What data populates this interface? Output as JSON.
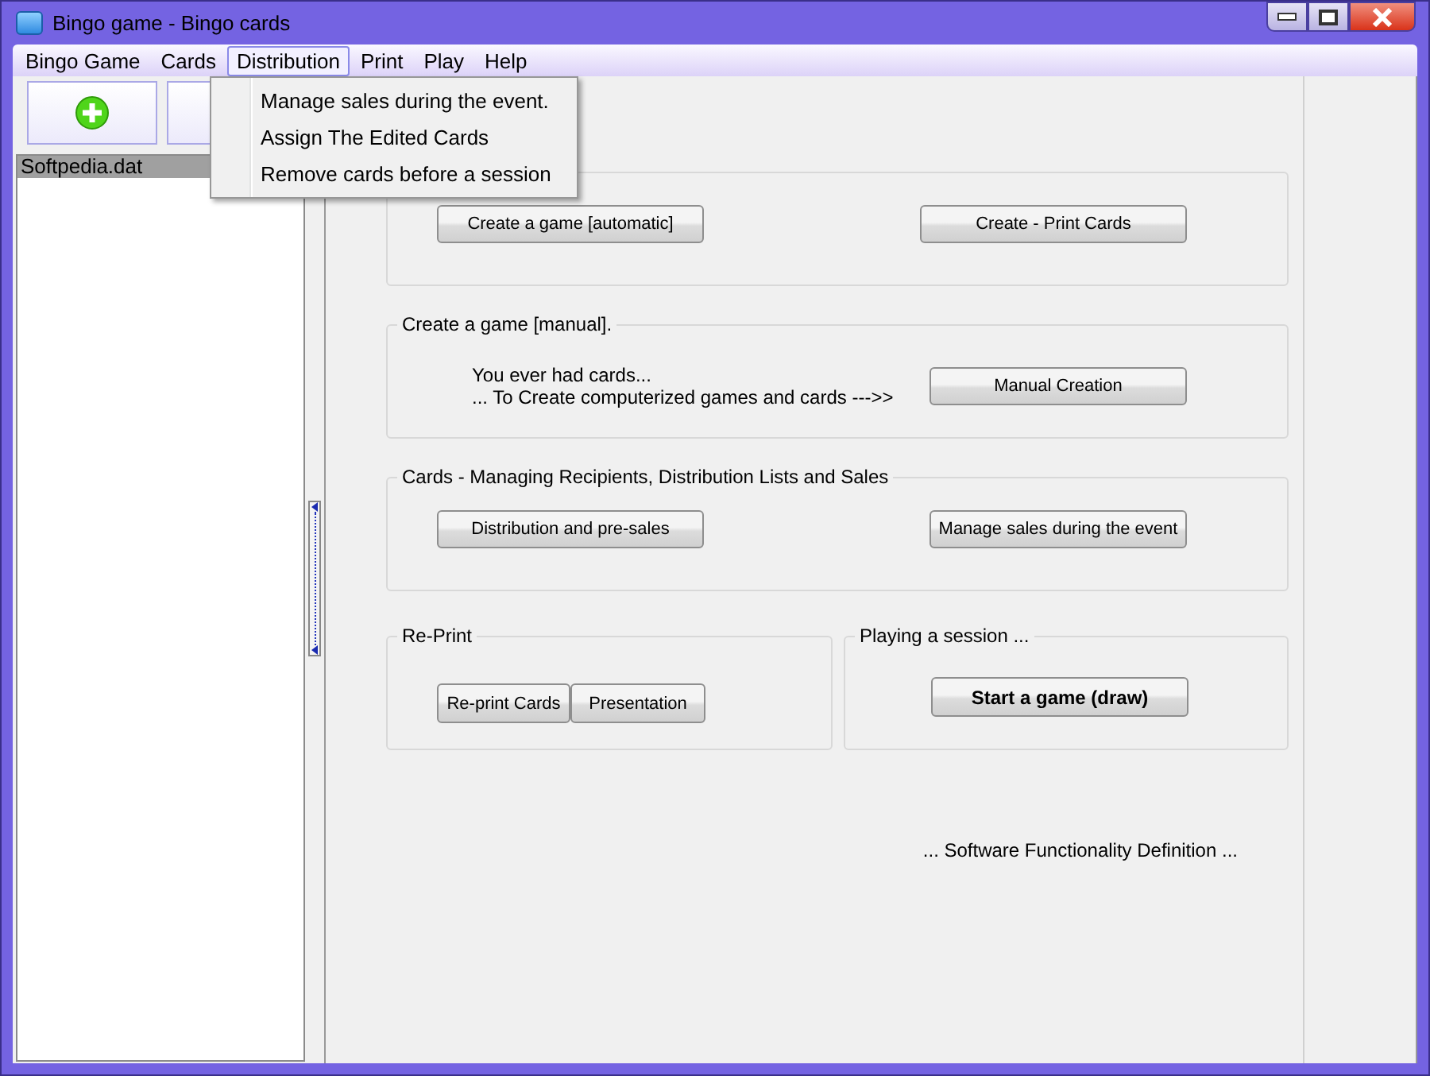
{
  "window": {
    "title": "Bingo game - Bingo cards"
  },
  "menu": [
    {
      "label": "Bingo Game",
      "selected": false
    },
    {
      "label": "Cards",
      "selected": false
    },
    {
      "label": "Distribution",
      "selected": true
    },
    {
      "label": "Print",
      "selected": false
    },
    {
      "label": "Play",
      "selected": false
    },
    {
      "label": "Help",
      "selected": false
    }
  ],
  "dropdown": [
    "Manage sales during the event.",
    "Assign The Edited Cards",
    "Remove cards before a session"
  ],
  "toolbar": [
    {
      "kind": "add"
    },
    {
      "kind": "blank"
    }
  ],
  "file_list": [
    {
      "label": "Softpedia.dat",
      "selected": true
    }
  ],
  "groups": [
    {
      "kind": "buttons",
      "buttons": [
        {
          "label": "Create a game [automatic]",
          "bold": false
        },
        {
          "label": "Create - Print Cards",
          "bold": false
        }
      ]
    },
    {
      "kind": "text",
      "title": "Create a game [manual].",
      "lines": [
        "You ever had cards...",
        "... To Create computerized games and cards --->>"
      ],
      "buttons": [
        {
          "label": "Manual Creation",
          "bold": false
        }
      ]
    },
    {
      "kind": "buttons",
      "title": "Cards - Managing Recipients, Distribution Lists and Sales",
      "buttons": [
        {
          "label": "Distribution and pre-sales",
          "bold": false
        },
        {
          "label": "Manage sales during the event",
          "bold": false
        }
      ]
    }
  ],
  "bottom_groups": [
    {
      "title": "Re-Print",
      "buttons": [
        {
          "label": "Re-print Cards",
          "bold": false
        },
        {
          "label": "Presentation",
          "bold": false
        }
      ]
    },
    {
      "title": "Playing a session  ...",
      "buttons": [
        {
          "label": "Start a game (draw)",
          "bold": true
        }
      ]
    }
  ],
  "footer": "... Software Functionality Definition ..."
}
